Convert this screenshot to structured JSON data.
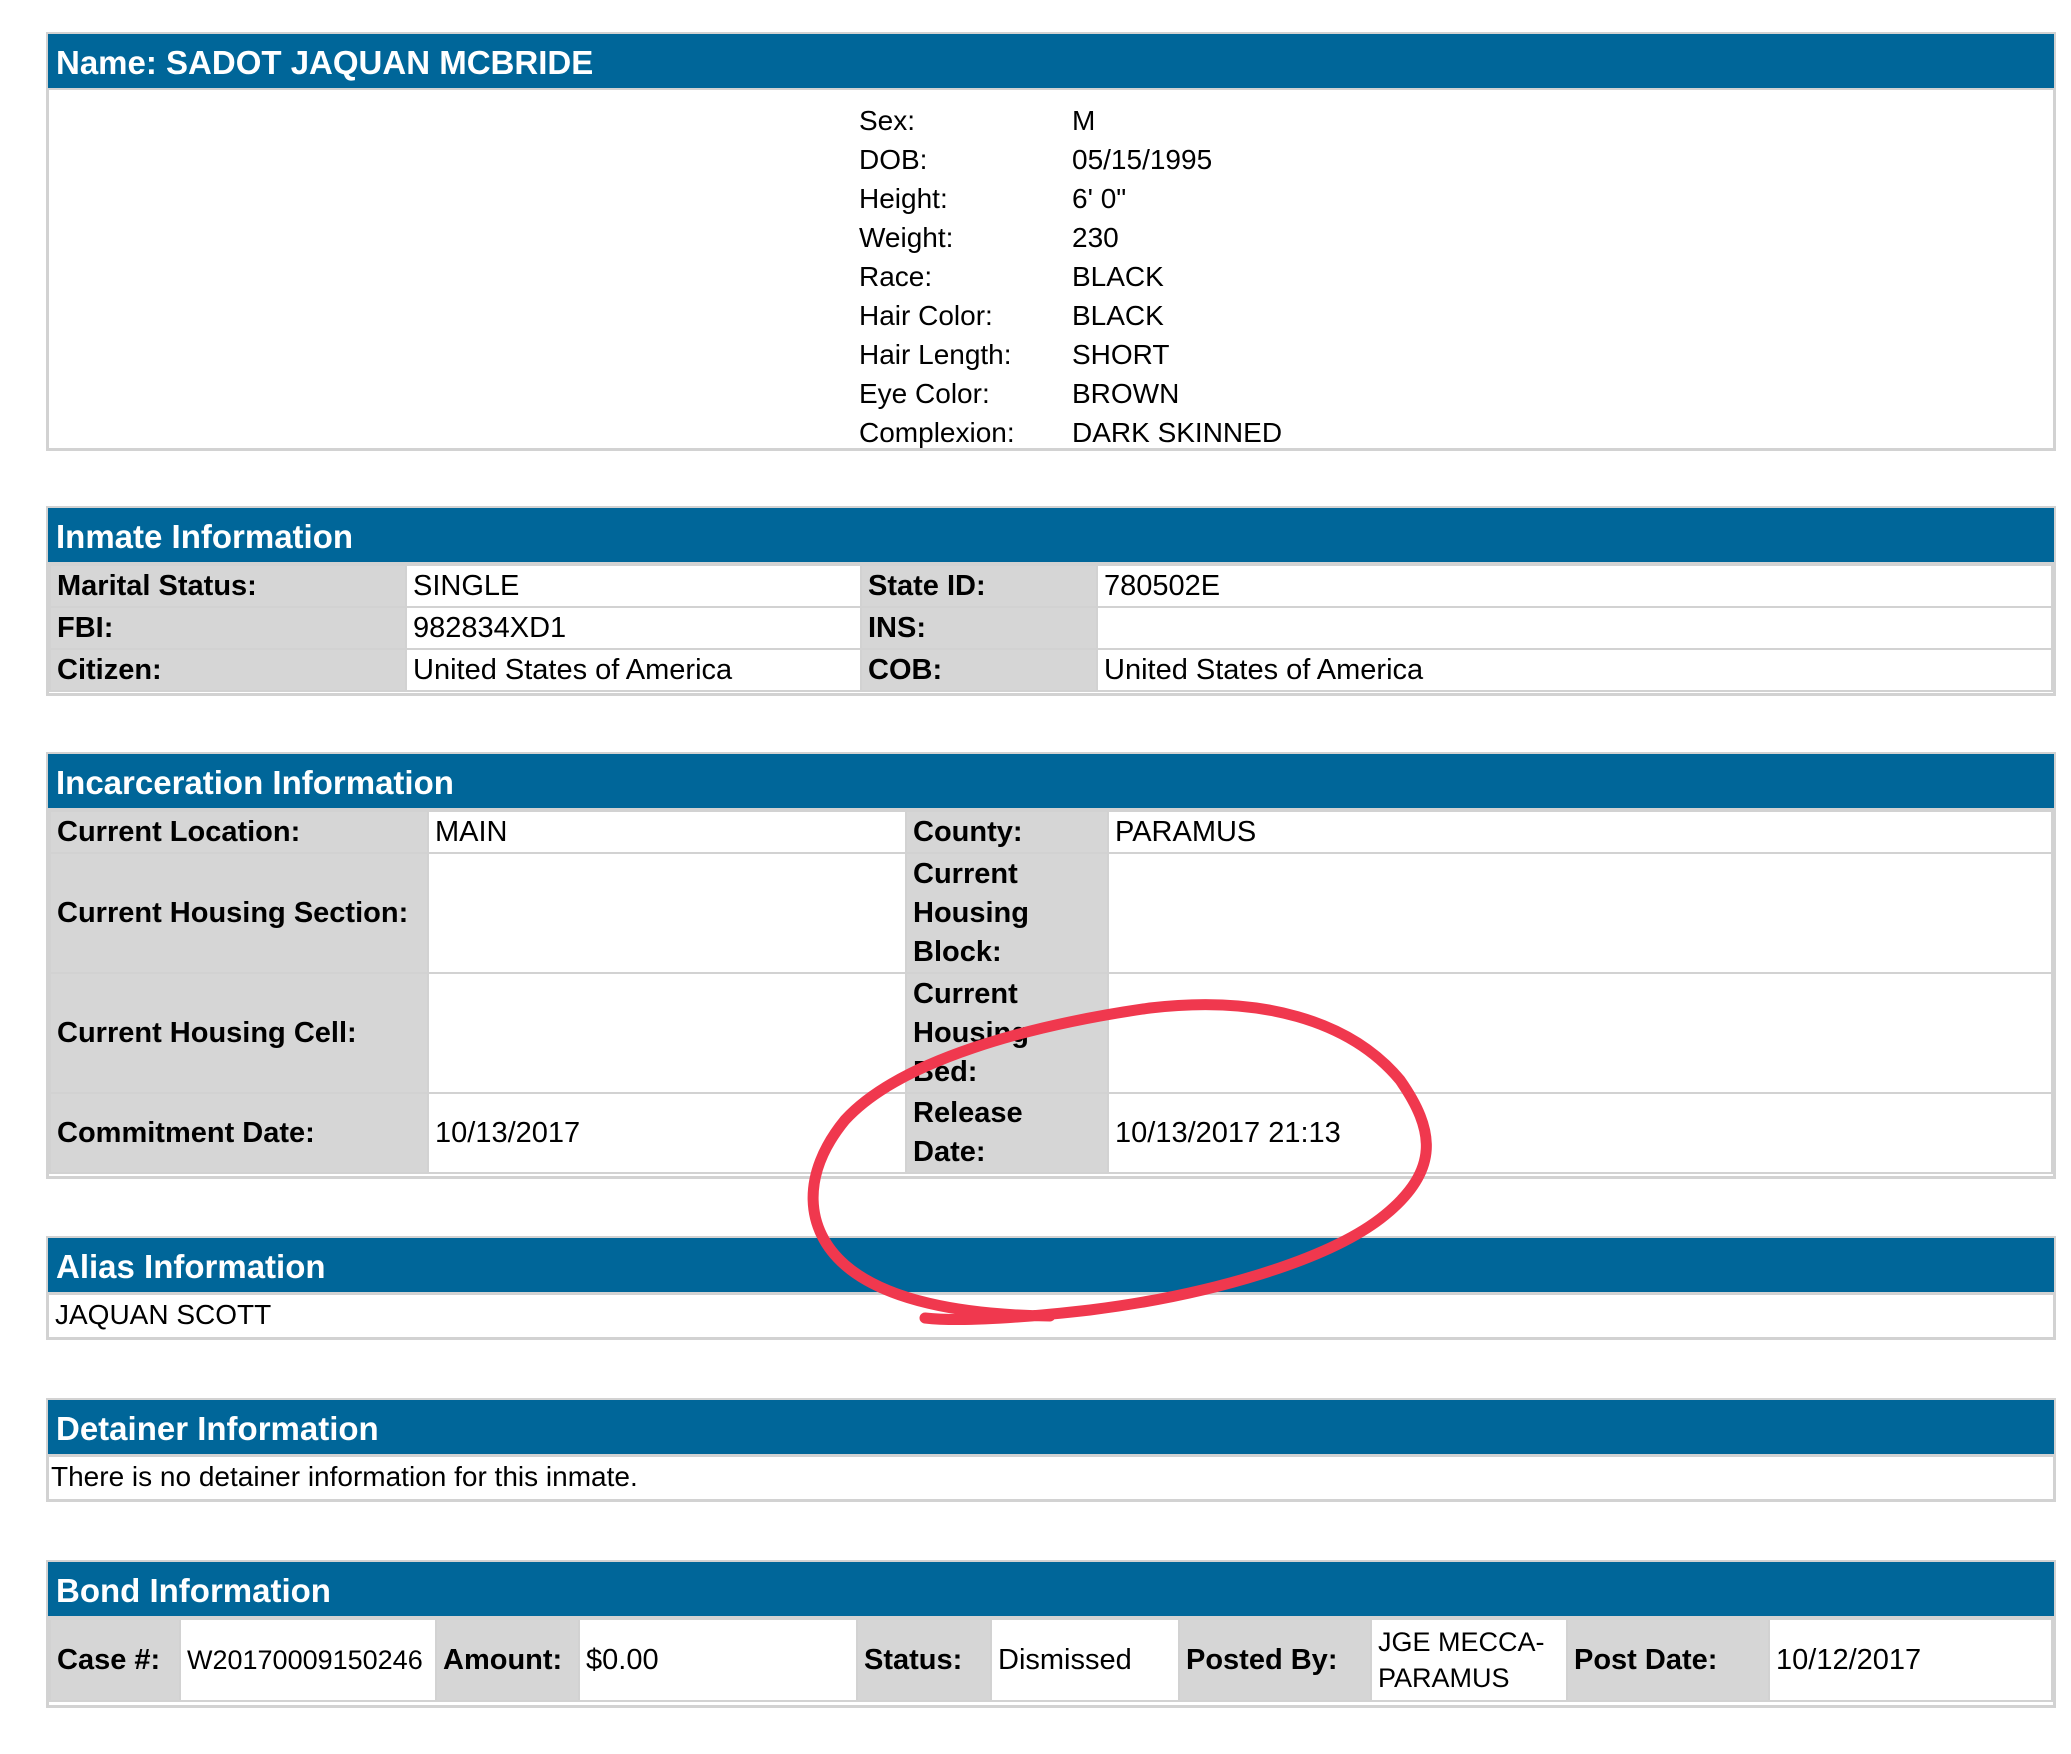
{
  "name_section": {
    "header": "Name: SADOT JAQUAN MCBRIDE",
    "details": [
      {
        "label": "Sex:",
        "value": "M"
      },
      {
        "label": "DOB:",
        "value": "05/15/1995"
      },
      {
        "label": "Height:",
        "value": "6' 0\""
      },
      {
        "label": "Weight:",
        "value": "230"
      },
      {
        "label": "Race:",
        "value": "BLACK"
      },
      {
        "label": "Hair Color:",
        "value": "BLACK"
      },
      {
        "label": "Hair Length:",
        "value": "SHORT"
      },
      {
        "label": "Eye Color:",
        "value": "BROWN"
      },
      {
        "label": "Complexion:",
        "value": "DARK SKINNED"
      }
    ]
  },
  "inmate_info": {
    "header": "Inmate Information",
    "rows": [
      {
        "l1": "Marital Status:",
        "v1": "SINGLE",
        "l2": "State ID:",
        "v2": "780502E"
      },
      {
        "l1": "FBI:",
        "v1": "982834XD1",
        "l2": "INS:",
        "v2": ""
      },
      {
        "l1": "Citizen:",
        "v1": "United States of America",
        "l2": "COB:",
        "v2": "United States of America"
      }
    ]
  },
  "incarceration_info": {
    "header": "Incarceration Information",
    "rows": [
      {
        "l1": "Current Location:",
        "v1": "MAIN",
        "l2": "County:",
        "v2": "PARAMUS"
      },
      {
        "l1": "Current Housing Section:",
        "v1": "",
        "l2": "Current Housing Block:",
        "v2": ""
      },
      {
        "l1": "Current Housing Cell:",
        "v1": "",
        "l2": "Current Housing Bed:",
        "v2": ""
      },
      {
        "l1": "Commitment Date:",
        "v1": "10/13/2017",
        "l2": "Release Date:",
        "v2": "10/13/2017 21:13"
      }
    ]
  },
  "alias_info": {
    "header": "Alias Information",
    "alias": "JAQUAN SCOTT"
  },
  "detainer_info": {
    "header": "Detainer Information",
    "message": "There is no detainer information for this inmate."
  },
  "bond_info": {
    "header": "Bond Information",
    "case_label": "Case #:",
    "case_value": "W20170009150246",
    "amount_label": "Amount:",
    "amount_value": "$0.00",
    "status_label": "Status:",
    "status_value": "Dismissed",
    "posted_by_label": "Posted By:",
    "posted_by_value": "JGE MECCA-PARAMUS",
    "post_date_label": "Post Date:",
    "post_date_value": "10/12/2017"
  },
  "colors": {
    "header_bg": "#006699",
    "label_bg": "#d6d6d6",
    "border": "#d2d2d2",
    "annotation": "#f0384e"
  }
}
